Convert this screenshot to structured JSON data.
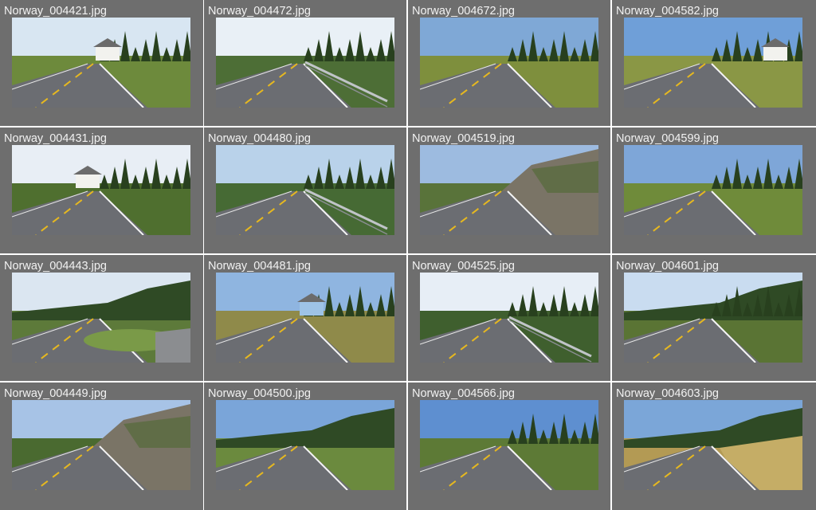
{
  "gallery": {
    "items": [
      {
        "filename": "Norway_004421.jpg",
        "scene": "house-right",
        "sky": "#d8e6f2",
        "grass": "#6d8a3c"
      },
      {
        "filename": "Norway_004472.jpg",
        "scene": "guardrail-right",
        "sky": "#e9f0f6",
        "grass": "#4d6e36"
      },
      {
        "filename": "Norway_004672.jpg",
        "scene": "trees-open",
        "sky": "#7fa8d6",
        "grass": "#7e8f3d"
      },
      {
        "filename": "Norway_004582.jpg",
        "scene": "house-far-right",
        "sky": "#6f9fd8",
        "grass": "#8a9745"
      },
      {
        "filename": "Norway_004431.jpg",
        "scene": "house-left",
        "sky": "#e8eef5",
        "grass": "#4f6f2f"
      },
      {
        "filename": "Norway_004480.jpg",
        "scene": "guardrail-valley",
        "sky": "#b9d2ea",
        "grass": "#466a34"
      },
      {
        "filename": "Norway_004519.jpg",
        "scene": "rock-cut",
        "sky": "#9dbbe0",
        "grass": "#59733a"
      },
      {
        "filename": "Norway_004599.jpg",
        "scene": "trees-open",
        "sky": "#7ea6d8",
        "grass": "#6f8b3a"
      },
      {
        "filename": "Norway_004443.jpg",
        "scene": "junction",
        "sky": "#dbe6f1",
        "grass": "#5d7a3a"
      },
      {
        "filename": "Norway_004481.jpg",
        "scene": "house-blue",
        "sky": "#8fb5e0",
        "grass": "#8f8a4a"
      },
      {
        "filename": "Norway_004525.jpg",
        "scene": "guardrail-trees",
        "sky": "#e7eef6",
        "grass": "#3f5f2e"
      },
      {
        "filename": "Norway_004601.jpg",
        "scene": "forest-right",
        "sky": "#c9dcf0",
        "grass": "#5a7434"
      },
      {
        "filename": "Norway_004449.jpg",
        "scene": "rock-right",
        "sky": "#a7c3e6",
        "grass": "#4a6a30"
      },
      {
        "filename": "Norway_004500.jpg",
        "scene": "hills-field",
        "sky": "#7aa5d9",
        "grass": "#6b8a3e"
      },
      {
        "filename": "Norway_004566.jpg",
        "scene": "trees-curve",
        "sky": "#5e8fd0",
        "grass": "#5d7a36"
      },
      {
        "filename": "Norway_004603.jpg",
        "scene": "hay-field",
        "sky": "#7ba6d8",
        "grass": "#b39a54"
      }
    ]
  }
}
